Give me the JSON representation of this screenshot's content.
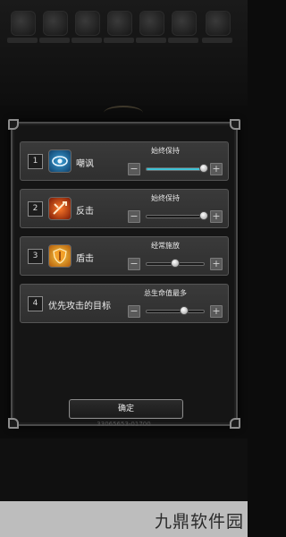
{
  "dialog": {
    "rows": [
      {
        "index": "1",
        "icon": "eye-icon",
        "name": "嘲讽",
        "option": "始终保持",
        "slider_fraction": 1.0,
        "slider_color": "#3ec3d6"
      },
      {
        "index": "2",
        "icon": "counter-attack-icon",
        "name": "反击",
        "option": "始终保持",
        "slider_fraction": 1.0,
        "slider_color": null
      },
      {
        "index": "3",
        "icon": "shield-icon",
        "name": "盾击",
        "option": "经常施放",
        "slider_fraction": 0.5,
        "slider_color": null
      },
      {
        "index": "4",
        "icon": null,
        "name": "优先攻击的目标",
        "option": "总生命值最多",
        "slider_fraction": 0.66,
        "slider_color": null
      }
    ],
    "ok_label": "确定"
  },
  "player_id": "33065653-01700",
  "watermark": "九鼎软件园",
  "colors": {
    "slider_active": "#3ec3d6",
    "panel": "#151515",
    "row": "#343434"
  }
}
